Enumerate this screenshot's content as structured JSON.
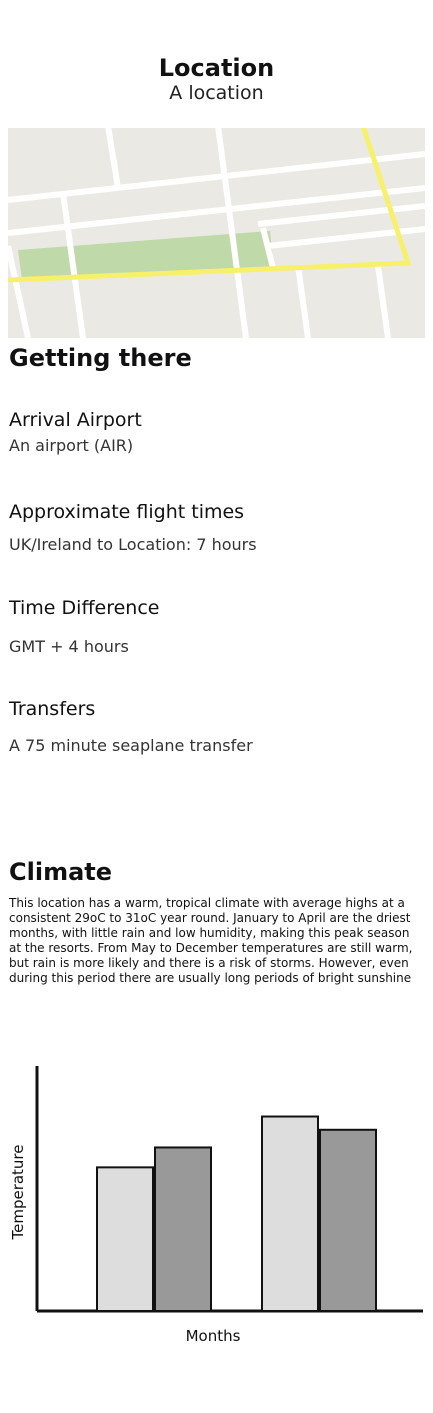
{
  "header": {
    "title": "Location",
    "subtitle": "A location"
  },
  "map": {
    "road_color": "#ffffff",
    "highlight_road_color": "#f7f06b",
    "park_color": "#c0d9a8",
    "land_color": "#ebe9e3"
  },
  "getting_there": {
    "heading": "Getting there",
    "arrival": {
      "title": "Arrival Airport",
      "value": "An airport (AIR)"
    },
    "flight": {
      "title": "Approximate flight times",
      "value": "UK/Ireland to Location: 7 hours"
    },
    "time_diff": {
      "title": "Time Difference",
      "value": "GMT + 4 hours"
    },
    "transfers": {
      "title": "Transfers",
      "value": "A 75 minute seaplane transfer"
    }
  },
  "climate": {
    "heading": "Climate",
    "text": "This location has a warm, tropical climate with average highs at a consistent 29oC to 31oC year round. January to April are the driest months, with little rain and low humidity, making this peak season at the resorts. From May to December temperatures are still warm, but rain is more likely and there is a risk of storms. However, even during this period there are usually long periods of bright sunshine"
  },
  "chart_data": {
    "type": "bar",
    "title": "",
    "xlabel": "Months",
    "ylabel": "Temperature",
    "categories": [
      "",
      ""
    ],
    "series": [
      {
        "color": "#dddddd",
        "values": [
          0.65,
          0.88
        ]
      },
      {
        "color": "#999999",
        "values": [
          0.74,
          0.82
        ]
      }
    ],
    "ylim": [
      0,
      1
    ]
  }
}
